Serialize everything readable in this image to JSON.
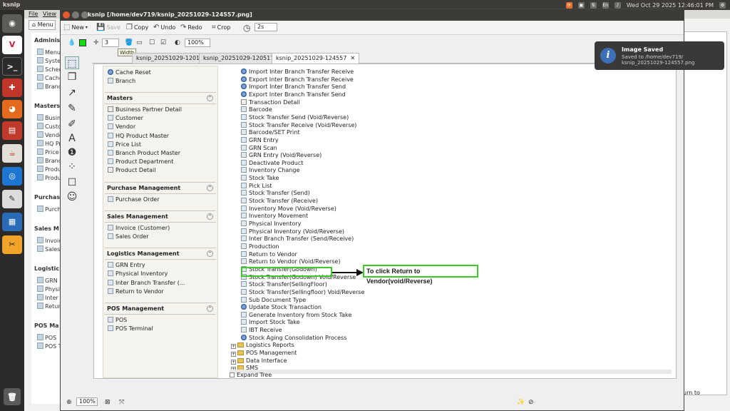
{
  "topbar": {
    "app": "ksnip",
    "keyboard": "En",
    "datetime": "Wed Oct 29 2025 12:46:01 PM"
  },
  "background_app": {
    "menu_file": "File",
    "menu_view": "View",
    "menu_button": "Menu",
    "sections": [
      {
        "title": "Adminis",
        "items": [
          "Menu",
          "Syste",
          "Schec",
          "Cache",
          "Branc"
        ]
      },
      {
        "title": "Masters",
        "items": [
          "Busin",
          "Custo",
          "Vendo",
          "HQ Pr",
          "Price",
          "Branc",
          "Produ",
          "Produ"
        ]
      },
      {
        "title": "Purchas",
        "items": [
          "Purch"
        ]
      },
      {
        "title": "Sales M",
        "items": [
          "Invoic",
          "Sales"
        ]
      },
      {
        "title": "Logistic",
        "items": [
          "GRN I",
          "Physic",
          "Inter I",
          "Returr"
        ]
      },
      {
        "title": "POS Ma",
        "items": [
          "POS",
          "POS T"
        ]
      }
    ],
    "right_text": "urn to"
  },
  "ksnip": {
    "title": "ksnip [/home/dev719/ksnip_20251029-124557.png]",
    "toolbar": {
      "new": "New",
      "save": "Save",
      "copy": "Copy",
      "undo": "Undo",
      "redo": "Redo",
      "crop": "Crop",
      "delay": "2s"
    },
    "tool_options": {
      "width": "3",
      "zoom": "100%",
      "tooltip": "Width"
    },
    "tabs": [
      {
        "label": "ksnip_20251029-120135",
        "active": false
      },
      {
        "label": "ksnip_20251029-120517",
        "active": false
      },
      {
        "label": "ksnip_20251029-124557",
        "active": true
      }
    ],
    "status_zoom": "100%"
  },
  "screenshot": {
    "left_panel": {
      "top_items": [
        {
          "label": "Cache Reset",
          "icon": "gear"
        },
        {
          "label": "Branch",
          "icon": "doc"
        }
      ],
      "sections": [
        {
          "title": "Masters",
          "items": [
            {
              "label": "Business Partner Detail",
              "icon": "page"
            },
            {
              "label": "Customer",
              "icon": "doc"
            },
            {
              "label": "Vendor",
              "icon": "doc"
            },
            {
              "label": "HQ Product Master",
              "icon": "doc"
            },
            {
              "label": "Price List",
              "icon": "doc"
            },
            {
              "label": "Branch Product Master",
              "icon": "doc"
            },
            {
              "label": "Product Department",
              "icon": "doc"
            },
            {
              "label": "Product Detail",
              "icon": "page"
            }
          ]
        },
        {
          "title": "Purchase Management",
          "items": [
            {
              "label": "Purchase Order",
              "icon": "doc"
            }
          ]
        },
        {
          "title": "Sales Management",
          "items": [
            {
              "label": "Invoice (Customer)",
              "icon": "doc"
            },
            {
              "label": "Sales Order",
              "icon": "doc"
            }
          ]
        },
        {
          "title": "Logistics Management",
          "items": [
            {
              "label": "GRN Entry",
              "icon": "doc"
            },
            {
              "label": "Physical Inventory",
              "icon": "doc"
            },
            {
              "label": "Inter Branch Transfer (...",
              "icon": "doc"
            },
            {
              "label": "Return to Vendor",
              "icon": "doc"
            }
          ]
        },
        {
          "title": "POS Management",
          "items": [
            {
              "label": "POS",
              "icon": "doc"
            },
            {
              "label": "POS Terminal",
              "icon": "doc"
            }
          ]
        }
      ]
    },
    "tree_items": [
      {
        "label": "Import Inter Branch Transfer Receive",
        "icon": "gear"
      },
      {
        "label": "Export Inter Branch Transfer Receive",
        "icon": "gear"
      },
      {
        "label": "Import Inter Branch Transfer Send",
        "icon": "gear"
      },
      {
        "label": "Export Inter Branch Transfer Send",
        "icon": "gear"
      },
      {
        "label": "Transaction Detail",
        "icon": "page"
      },
      {
        "label": "Barcode",
        "icon": "doc"
      },
      {
        "label": "Stock Transfer Send (Void/Reverse)",
        "icon": "doc"
      },
      {
        "label": "Stock Transfer Receive (Void/Reverse)",
        "icon": "doc"
      },
      {
        "label": "Barcode/SET Print",
        "icon": "doc"
      },
      {
        "label": "GRN Entry",
        "icon": "doc"
      },
      {
        "label": "GRN Scan",
        "icon": "doc"
      },
      {
        "label": "GRN Entry (Void/Reverse)",
        "icon": "doc"
      },
      {
        "label": "Deactivate Product",
        "icon": "doc"
      },
      {
        "label": "Inventory Change",
        "icon": "doc"
      },
      {
        "label": "Stock Take",
        "icon": "doc"
      },
      {
        "label": "Pick List",
        "icon": "doc"
      },
      {
        "label": "Stock Transfer (Send)",
        "icon": "doc"
      },
      {
        "label": "Stock Transfer (Receive)",
        "icon": "doc"
      },
      {
        "label": "Inventory Move (Void/Reverse)",
        "icon": "doc"
      },
      {
        "label": "Inventory Movement",
        "icon": "doc"
      },
      {
        "label": "Physical Inventory",
        "icon": "doc"
      },
      {
        "label": "Physical Inventory (Void/Reverse)",
        "icon": "doc"
      },
      {
        "label": "Inter Branch Transfer (Send/Receive)",
        "icon": "doc"
      },
      {
        "label": "Production",
        "icon": "doc"
      },
      {
        "label": "Return to Vendor",
        "icon": "doc"
      },
      {
        "label": "Return to Vendor (Void/Reverse)",
        "icon": "doc"
      },
      {
        "label": "Stock Transfer(Godown)",
        "icon": "doc"
      },
      {
        "label": "Stock Transfer(Godown) Void/Reverse",
        "icon": "doc"
      },
      {
        "label": "Stock Transfer(SellingFloor)",
        "icon": "doc"
      },
      {
        "label": "Stock Transfer(Sellingfloor) Void/Reverse",
        "icon": "doc"
      },
      {
        "label": "Sub Document Type",
        "icon": "doc"
      },
      {
        "label": "Update Stock Transaction",
        "icon": "gear"
      },
      {
        "label": "Generate Inventory from Stock Take",
        "icon": "doc"
      },
      {
        "label": "Import Stock Take",
        "icon": "doc"
      },
      {
        "label": "IBT Receive",
        "icon": "doc"
      },
      {
        "label": "Stock Aging Consolidation Process",
        "icon": "gear"
      }
    ],
    "tree_folders": [
      "Logistics Reports",
      "POS Management",
      "Data Interface",
      "SMS"
    ],
    "expand_tree": "Expand Tree",
    "callout": "To click Return to Vendor(void/Reverse)"
  },
  "notification": {
    "title": "Image Saved",
    "body_line1": "Saved to /home/dev719/",
    "body_line2": "ksnip_20251029-124557.png"
  }
}
